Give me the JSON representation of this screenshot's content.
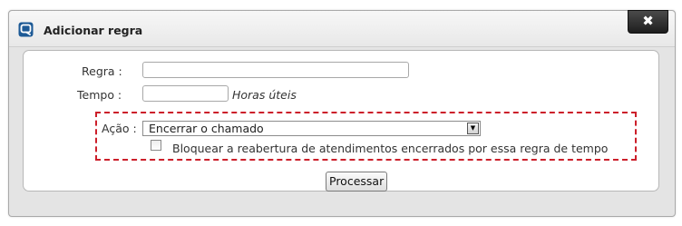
{
  "dialog": {
    "title": "Adicionar regra",
    "close_label": "✖"
  },
  "form": {
    "regra_label": "Regra :",
    "regra_value": "",
    "tempo_label": "Tempo :",
    "tempo_value": "",
    "tempo_hint": "Horas úteis",
    "acao_label": "Ação :",
    "acao_selected": "Encerrar o chamado",
    "bloquear_checked": false,
    "bloquear_label": "Bloquear a reabertura de atendimentos encerrados por essa regra de tempo",
    "submit_label": "Processar"
  },
  "colors": {
    "highlight_border": "#cc1f2a",
    "logo_blue": "#1d5a96"
  },
  "icons": {
    "logo": "app-logo-icon",
    "close": "close-icon",
    "dropdown": "chevron-down-icon"
  }
}
